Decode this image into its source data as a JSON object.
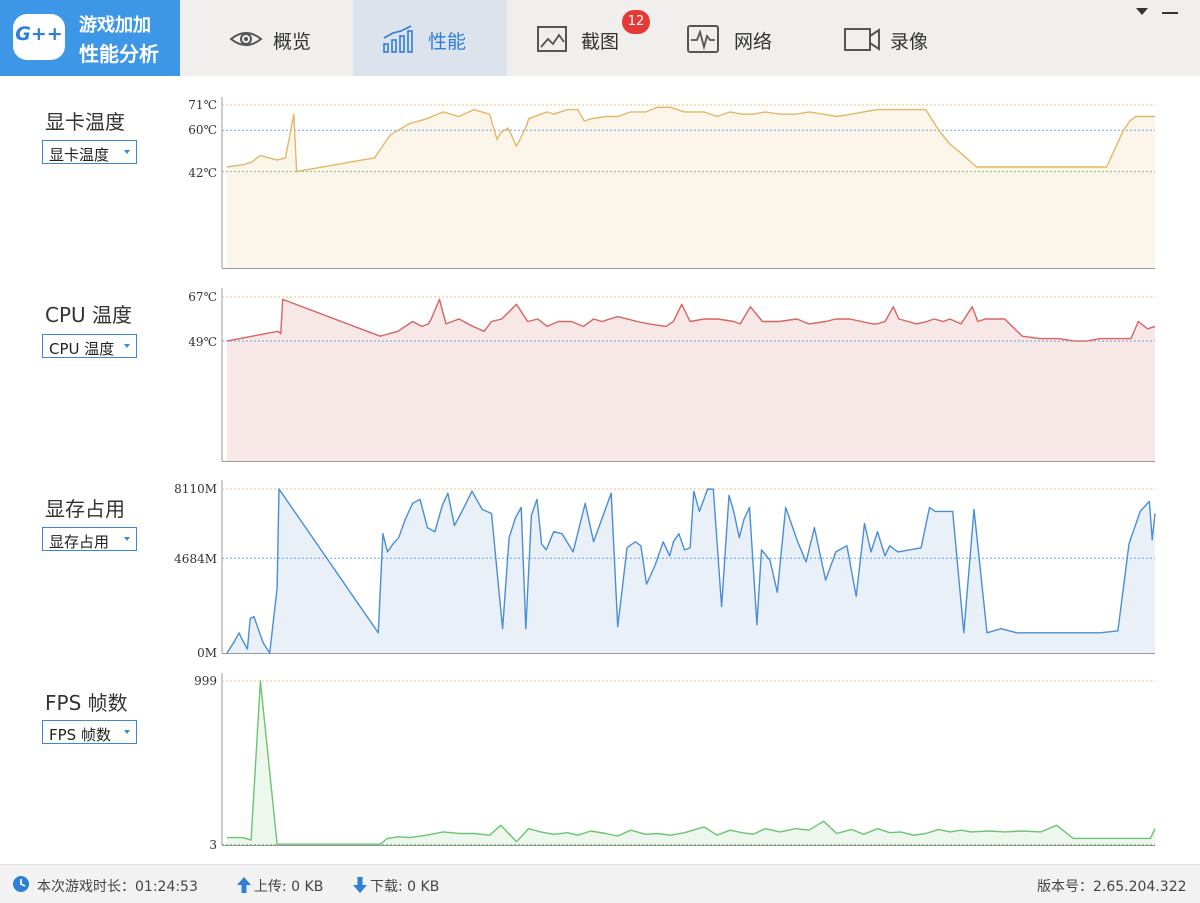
{
  "app": {
    "logo_badge": "G++",
    "logo_line1": "游戏加加",
    "logo_line2": "性能分析"
  },
  "tabs": [
    {
      "label": "概览",
      "icon": "eye-icon",
      "active": false
    },
    {
      "label": "性能",
      "icon": "performance-chart-icon",
      "active": true
    },
    {
      "label": "截图",
      "icon": "screenshot-image-icon",
      "active": false,
      "badge": "12"
    },
    {
      "label": "网络",
      "icon": "network-pulse-icon",
      "active": false
    },
    {
      "label": "录像",
      "icon": "video-camera-icon",
      "active": false
    }
  ],
  "window_controls": [
    "dropdown-icon",
    "minimize-icon"
  ],
  "sidebar": {
    "gpu_temp": {
      "label": "显卡温度",
      "select": "显卡温度"
    },
    "cpu_temp": {
      "label": "CPU 温度",
      "select": "CPU 温度"
    },
    "vram": {
      "label": "显存占用",
      "select": "显存占用"
    },
    "fps": {
      "label": "FPS 帧数",
      "select": "FPS 帧数"
    }
  },
  "colors": {
    "accent": "#3d96e6",
    "gpu_line": "#e4b766",
    "gpu_fill": "#fbf5ea",
    "cpu_line": "#d66462",
    "cpu_fill": "#f7e7e6",
    "vram_line": "#4a8ed6",
    "vram_fill": "#e9f0f8",
    "fps_line": "#6cc472",
    "fps_fill": "#edf7ee",
    "ref_max": "#f1c27a",
    "ref_avg": "#6aa9e6",
    "ref_min": "#7ec77e"
  },
  "chart_data": [
    {
      "type": "area",
      "name": "gpu-temperature",
      "ticks": [
        "71℃",
        "60℃",
        "42℃"
      ],
      "ref_lines": {
        "max": 71,
        "avg": 60,
        "min": 42
      },
      "ylim": [
        0,
        71
      ],
      "x": [
        0,
        1.7,
        2.6,
        3.6,
        4.5,
        5.4,
        6.3,
        7.2,
        7.5,
        15.9,
        17.6,
        19.7,
        21.5,
        23.3,
        25,
        26.6,
        28.3,
        29.1,
        29.5,
        30.3,
        31.2,
        32.3,
        32.5,
        33.8,
        34.5,
        35.2,
        36.7,
        37.8,
        38.5,
        39.2,
        40.8,
        42.1,
        43.5,
        45.1,
        46.4,
        47.8,
        49.3,
        51.4,
        52.8,
        54.2,
        55.5,
        56.7,
        58,
        59.6,
        61.3,
        62.7,
        64.3,
        65.7,
        67.3,
        68.6,
        70.1,
        71.4,
        72.6,
        74,
        75.3,
        76.7,
        77.9,
        79.1,
        80.2,
        80.8,
        82.1,
        82.8,
        83.8,
        84.6,
        85,
        85.6,
        86,
        86.8,
        87.7,
        89.4,
        91.2,
        93,
        94.8,
        96.6,
        97.3,
        97.9,
        98.7,
        100
      ],
      "values": [
        44,
        45,
        46,
        49,
        48,
        47,
        48,
        67,
        42,
        48,
        58,
        63,
        65,
        68,
        66,
        69,
        67,
        56,
        59,
        61,
        53,
        62,
        65,
        67,
        68,
        67,
        69,
        69,
        64,
        65,
        66,
        66,
        68,
        68,
        70,
        70,
        68,
        68,
        66,
        68,
        67,
        67,
        68,
        67,
        67,
        68,
        67,
        66,
        67,
        68,
        69,
        69,
        69,
        69,
        69,
        60,
        54,
        50,
        46,
        44,
        44,
        44,
        44,
        44,
        44,
        44,
        44,
        44,
        44,
        44,
        44,
        44,
        44,
        60,
        64,
        66,
        66,
        66
      ]
    },
    {
      "type": "area",
      "name": "cpu-temperature",
      "ticks": [
        "67℃",
        "49℃"
      ],
      "ref_lines": {
        "max": 67,
        "avg": 49
      },
      "ylim": [
        0,
        67
      ],
      "x": [
        0,
        2.7,
        5.5,
        5.8,
        6,
        16.5,
        18.4,
        20,
        21,
        21.7,
        22,
        22.9,
        23.6,
        25,
        26.5,
        27.7,
        28.5,
        29.6,
        31.2,
        32.4,
        33.5,
        34.5,
        35.7,
        37.1,
        38.4,
        39.5,
        40.4,
        42.1,
        44.2,
        45.5,
        47.3,
        48.1,
        49,
        49.9,
        51.4,
        52.9,
        54.6,
        55.3,
        56.4,
        57.7,
        59.5,
        61.4,
        62.7,
        64.5,
        65.6,
        67.1,
        68.4,
        69.6,
        70,
        70.9,
        71.8,
        72.4,
        73.4,
        74.3,
        75.4,
        76.2,
        77.2,
        77.9,
        79.1,
        80.3,
        80.9,
        81.7,
        82.7,
        83.8,
        85.7,
        87.6,
        89.6,
        91.4,
        92.6,
        94.1,
        96.6,
        97.4,
        98.2,
        99.2,
        100
      ],
      "values": [
        49,
        51,
        53,
        52,
        66,
        51,
        53,
        57,
        55,
        56,
        58,
        66,
        56,
        58,
        55,
        53,
        57,
        58,
        64,
        57,
        58,
        55,
        57,
        57,
        55,
        58,
        57,
        59,
        57,
        56,
        55,
        57,
        64,
        57,
        58,
        58,
        57,
        56,
        63,
        57,
        57,
        58,
        56,
        57,
        58,
        58,
        57,
        56,
        56,
        57,
        63,
        58,
        57,
        56,
        57,
        58,
        57,
        58,
        56,
        63,
        57,
        58,
        58,
        58,
        51,
        50,
        50,
        49,
        49,
        50,
        50,
        50,
        57,
        54,
        55
      ]
    },
    {
      "type": "area",
      "name": "vram-usage",
      "ticks": [
        "8110M",
        "4684M",
        "0M"
      ],
      "ref_lines": {
        "max": 8110,
        "avg": 4684
      },
      "ylim": [
        0,
        8110
      ],
      "x": [
        0,
        0.7,
        1.3,
        1.6,
        2.2,
        2.5,
        2.9,
        3.9,
        4.6,
        5.4,
        5.6,
        16.3,
        16.8,
        17.3,
        17.9,
        18.5,
        19.2,
        20,
        20.8,
        21.6,
        22.4,
        23.2,
        23.8,
        24.5,
        25.2,
        26.4,
        27.5,
        28.5,
        29.7,
        30.4,
        31.1,
        31.7,
        32.2,
        32.8,
        33.4,
        33.9,
        34.4,
        35.2,
        36.1,
        37.3,
        38.6,
        39.5,
        40.6,
        41.4,
        42.1,
        42.6,
        43.1,
        44,
        44.6,
        45.2,
        46.1,
        47,
        47.7,
        48.1,
        48.7,
        49.3,
        49.9,
        50.3,
        50.9,
        51.8,
        52.4,
        53.3,
        54.1,
        54.6,
        55.2,
        55.7,
        56.3,
        57.1,
        57.6,
        58.5,
        59.3,
        60.2,
        61.5,
        62.4,
        63.3,
        64.5,
        65.6,
        66.8,
        67.8,
        68.7,
        69.4,
        70.1,
        70.9,
        71.4,
        72.3,
        73.5,
        74.8,
        75.7,
        76.3,
        76.7,
        77.3,
        78.2,
        79.4,
        80.5,
        81.9,
        83.4,
        85.1,
        86.4,
        87.9,
        89.6,
        91.4,
        92.6,
        94.1,
        96,
        97.2,
        98.4,
        99.4,
        99.7,
        100
      ],
      "values": [
        0,
        500,
        1000,
        700,
        200,
        1700,
        1800,
        500,
        0,
        3200,
        8110,
        1000,
        5900,
        5000,
        5400,
        5700,
        6600,
        7400,
        7600,
        6200,
        6000,
        7300,
        7900,
        6300,
        6900,
        8000,
        7100,
        6900,
        1200,
        5700,
        6700,
        7200,
        1200,
        6800,
        7600,
        5400,
        5100,
        6000,
        5900,
        5000,
        7400,
        5500,
        6900,
        7900,
        1300,
        3200,
        5200,
        5500,
        5300,
        3400,
        4300,
        5500,
        4800,
        5500,
        5900,
        5100,
        5200,
        8000,
        7000,
        8110,
        8100,
        2300,
        7800,
        7000,
        5700,
        6600,
        7200,
        1400,
        5100,
        4600,
        3000,
        7200,
        5500,
        4500,
        6200,
        3600,
        5000,
        5300,
        2800,
        6400,
        5000,
        6000,
        4800,
        5300,
        5000,
        5100,
        5200,
        7200,
        7000,
        7000,
        7000,
        7000,
        1000,
        7100,
        1000,
        1200,
        1000,
        1000,
        1000,
        1000,
        1000,
        1000,
        1000,
        1100,
        5400,
        7000,
        7500,
        5600,
        6900
      ]
    },
    {
      "type": "area",
      "name": "fps",
      "ticks": [
        "999",
        "3"
      ],
      "ref_lines": {
        "max": 999,
        "min": 3
      },
      "ylim": [
        0,
        999
      ],
      "x": [
        0,
        1.7,
        2.6,
        3.6,
        5.4,
        16.5,
        17.3,
        18.4,
        19.7,
        21.5,
        23.3,
        25,
        26.6,
        28.3,
        29.5,
        31.2,
        32.5,
        33.8,
        35.2,
        36.7,
        37.8,
        39.2,
        40.8,
        42.1,
        43.5,
        45.1,
        46.4,
        47.8,
        49.3,
        51.4,
        52.8,
        54.2,
        55.5,
        56.7,
        58,
        59.6,
        61.3,
        62.7,
        64.3,
        65.7,
        67.3,
        68.6,
        70.1,
        71.4,
        72.6,
        74,
        75.3,
        76.7,
        77.9,
        79.1,
        80.2,
        82.1,
        83.8,
        85.6,
        87.7,
        89.4,
        91.2,
        93,
        94.8,
        96.6,
        97.9,
        98.7,
        99.5,
        100
      ],
      "values": [
        45,
        45,
        30,
        999,
        5,
        5,
        40,
        50,
        45,
        60,
        80,
        70,
        70,
        60,
        120,
        20,
        100,
        80,
        65,
        75,
        60,
        85,
        70,
        55,
        90,
        65,
        70,
        60,
        75,
        110,
        60,
        90,
        75,
        65,
        100,
        80,
        100,
        90,
        145,
        70,
        95,
        65,
        100,
        75,
        80,
        60,
        70,
        95,
        80,
        90,
        80,
        85,
        80,
        85,
        80,
        120,
        40,
        40,
        40,
        40,
        40,
        40,
        40,
        100
      ]
    }
  ],
  "status": {
    "session_time": "本次游戏时长：01:24:53",
    "upload": "上传: 0 KB",
    "download": "下载: 0 KB",
    "version": "版本号：2.65.204.322"
  }
}
